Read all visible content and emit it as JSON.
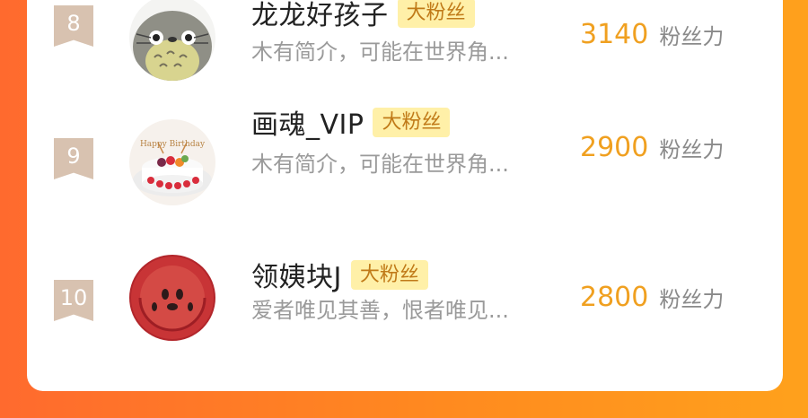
{
  "ranking": {
    "rows": [
      {
        "rank": "8",
        "name": "龙龙好孩子",
        "tag": "大粉丝",
        "intro": "木有简介，可能在世界角...",
        "score": "3140",
        "score_unit": "粉丝力",
        "avatar": "totoro-avatar"
      },
      {
        "rank": "9",
        "name": "画魂_VIP",
        "tag": "大粉丝",
        "intro": "木有简介，可能在世界角...",
        "score": "2900",
        "score_unit": "粉丝力",
        "avatar": "birthday-cake-avatar",
        "avatar_text": "Happy Birthday"
      },
      {
        "rank": "10",
        "name": "领姨块J",
        "tag": "大粉丝",
        "intro": "爱者唯见其善，恨者唯见...",
        "score": "2800",
        "score_unit": "粉丝力",
        "avatar": "watermelon-avatar"
      }
    ]
  },
  "colors": {
    "background_start": "#ff6a2e",
    "background_end": "#ffa11c",
    "rank_badge": "#d8c2b0",
    "tag_background": "#fff0a8",
    "tag_text": "#c07a18",
    "score": "#f0a020",
    "intro": "#9a9a9a"
  }
}
